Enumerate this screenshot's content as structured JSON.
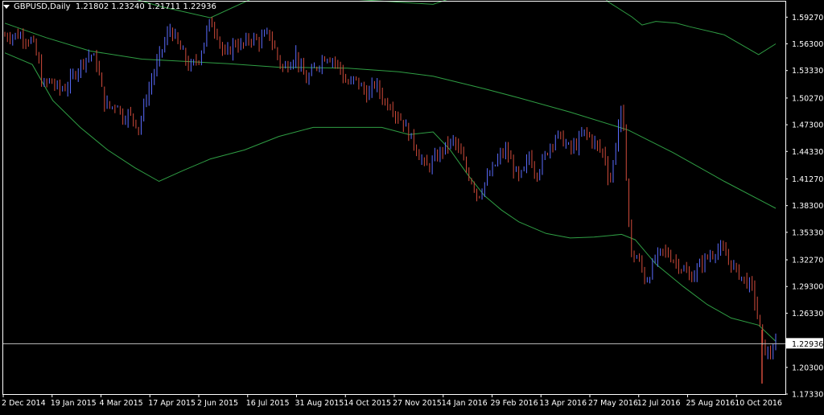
{
  "window": {
    "symbol": "GBPUSD,Daily",
    "ohlc": "1.21802 1.23240 1.21711 1.22936"
  },
  "colors": {
    "background": "#000000",
    "frame": "#ffffff",
    "bull_bar": "#5b6cff",
    "bear_bar": "#d14b3b",
    "band": "#2f9e44",
    "current_price_line": "#c0c0c0",
    "price_label_bg": "#ffffff",
    "price_label_text": "#000000",
    "axis_text": "#ffffff"
  },
  "chart_data": {
    "type": "ohlc-bar",
    "symbol": "GBPUSD",
    "timeframe": "Daily",
    "current_price": 1.22936,
    "y_ticks": [
      "1.59270",
      "1.56300",
      "1.53330",
      "1.50270",
      "1.47300",
      "1.44330",
      "1.41270",
      "1.38300",
      "1.35330",
      "1.32270",
      "1.29300",
      "1.26330",
      "1.20300",
      "1.17330"
    ],
    "ylim": [
      1.1733,
      1.61
    ],
    "x_ticks": [
      "2 Dec 2014",
      "19 Jan 2015",
      "4 Mar 2015",
      "17 Apr 2015",
      "2 Jun 2015",
      "16 Jul 2015",
      "31 Aug 2015",
      "14 Oct 2015",
      "27 Nov 2015",
      "14 Jan 2016",
      "29 Feb 2016",
      "13 Apr 2016",
      "27 May 2016",
      "12 Jul 2016",
      "25 Aug 2016",
      "10 Oct 2016"
    ],
    "price_path": [
      [
        0,
        1.572
      ],
      [
        4,
        1.573
      ],
      [
        8,
        1.566
      ],
      [
        10,
        1.54
      ],
      [
        11,
        1.515
      ],
      [
        13,
        1.522
      ],
      [
        16,
        1.512
      ],
      [
        18,
        1.515
      ],
      [
        20,
        1.528
      ],
      [
        23,
        1.545
      ],
      [
        25,
        1.552
      ],
      [
        27,
        1.54
      ],
      [
        28,
        1.518
      ],
      [
        29,
        1.497
      ],
      [
        31,
        1.492
      ],
      [
        33,
        1.498
      ],
      [
        34,
        1.48
      ],
      [
        36,
        1.485
      ],
      [
        38,
        1.478
      ],
      [
        39,
        1.468
      ],
      [
        41,
        1.5
      ],
      [
        43,
        1.525
      ],
      [
        45,
        1.548
      ],
      [
        47,
        1.568
      ],
      [
        48,
        1.58
      ],
      [
        49,
        1.575
      ],
      [
        51,
        1.558
      ],
      [
        52,
        1.552
      ],
      [
        54,
        1.535
      ],
      [
        56,
        1.545
      ],
      [
        57,
        1.55
      ],
      [
        59,
        1.578
      ],
      [
        60,
        1.588
      ],
      [
        62,
        1.575
      ],
      [
        63,
        1.562
      ],
      [
        64,
        1.548
      ],
      [
        66,
        1.558
      ],
      [
        67,
        1.565
      ],
      [
        69,
        1.56
      ],
      [
        71,
        1.567
      ],
      [
        72,
        1.57
      ],
      [
        74,
        1.565
      ],
      [
        76,
        1.572
      ],
      [
        77,
        1.575
      ],
      [
        79,
        1.555
      ],
      [
        80,
        1.545
      ],
      [
        81,
        1.535
      ],
      [
        83,
        1.542
      ],
      [
        85,
        1.552
      ],
      [
        86,
        1.538
      ],
      [
        88,
        1.522
      ],
      [
        89,
        1.528
      ],
      [
        91,
        1.538
      ],
      [
        93,
        1.548
      ],
      [
        94,
        1.55
      ],
      [
        96,
        1.545
      ],
      [
        98,
        1.535
      ],
      [
        99,
        1.522
      ],
      [
        101,
        1.518
      ],
      [
        102,
        1.525
      ],
      [
        104,
        1.515
      ],
      [
        106,
        1.505
      ],
      [
        108,
        1.52
      ],
      [
        109,
        1.512
      ],
      [
        111,
        1.498
      ],
      [
        113,
        1.495
      ],
      [
        114,
        1.485
      ],
      [
        116,
        1.478
      ],
      [
        118,
        1.462
      ],
      [
        120,
        1.448
      ],
      [
        121,
        1.438
      ],
      [
        123,
        1.425
      ],
      [
        125,
        1.432
      ],
      [
        127,
        1.442
      ],
      [
        129,
        1.45
      ],
      [
        131,
        1.455
      ],
      [
        133,
        1.44
      ],
      [
        135,
        1.42
      ],
      [
        137,
        1.405
      ],
      [
        138,
        1.392
      ],
      [
        140,
        1.408
      ],
      [
        142,
        1.42
      ],
      [
        144,
        1.435
      ],
      [
        146,
        1.445
      ],
      [
        148,
        1.43
      ],
      [
        150,
        1.412
      ],
      [
        152,
        1.425
      ],
      [
        153,
        1.44
      ],
      [
        155,
        1.418
      ],
      [
        157,
        1.432
      ],
      [
        159,
        1.45
      ],
      [
        161,
        1.462
      ],
      [
        163,
        1.455
      ],
      [
        165,
        1.445
      ],
      [
        167,
        1.452
      ],
      [
        169,
        1.465
      ],
      [
        171,
        1.458
      ],
      [
        173,
        1.448
      ],
      [
        175,
        1.44
      ],
      [
        176,
        1.418
      ],
      [
        177,
        1.412
      ],
      [
        178,
        1.445
      ],
      [
        179,
        1.47
      ],
      [
        180,
        1.492
      ],
      [
        181,
        1.442
      ],
      [
        182,
        1.375
      ],
      [
        183,
        1.32
      ],
      [
        184,
        1.33
      ],
      [
        186,
        1.312
      ],
      [
        187,
        1.298
      ],
      [
        188,
        1.305
      ],
      [
        190,
        1.325
      ],
      [
        192,
        1.332
      ],
      [
        194,
        1.328
      ],
      [
        196,
        1.32
      ],
      [
        198,
        1.312
      ],
      [
        200,
        1.302
      ],
      [
        202,
        1.312
      ],
      [
        204,
        1.322
      ],
      [
        206,
        1.328
      ],
      [
        208,
        1.335
      ],
      [
        210,
        1.33
      ],
      [
        212,
        1.318
      ],
      [
        214,
        1.308
      ],
      [
        216,
        1.3
      ],
      [
        218,
        1.292
      ],
      [
        219,
        1.275
      ],
      [
        220,
        1.255
      ],
      [
        221,
        1.23
      ],
      [
        222,
        1.222
      ],
      [
        223,
        1.215
      ],
      [
        224,
        1.225
      ],
      [
        225,
        1.228
      ]
    ],
    "flash_crash": {
      "index": 221,
      "low": 1.185,
      "high": 1.245
    },
    "upper_band": [
      [
        0,
        1.659
      ],
      [
        14,
        1.642
      ],
      [
        30,
        1.622
      ],
      [
        45,
        1.605
      ],
      [
        60,
        1.592
      ],
      [
        72,
        1.613
      ],
      [
        78,
        1.613
      ],
      [
        100,
        1.613
      ],
      [
        125,
        1.607
      ],
      [
        132,
        1.616
      ],
      [
        138,
        1.627
      ],
      [
        150,
        1.632
      ],
      [
        165,
        1.64
      ],
      [
        172,
        1.628
      ],
      [
        176,
        1.61
      ],
      [
        183,
        1.593
      ],
      [
        186,
        1.584
      ],
      [
        190,
        1.588
      ],
      [
        196,
        1.586
      ],
      [
        200,
        1.582
      ],
      [
        210,
        1.573
      ],
      [
        220,
        1.551
      ],
      [
        225,
        1.563
      ]
    ],
    "middle_band": [
      [
        0,
        1.586
      ],
      [
        12,
        1.57
      ],
      [
        25,
        1.555
      ],
      [
        40,
        1.546
      ],
      [
        55,
        1.543
      ],
      [
        65,
        1.541
      ],
      [
        80,
        1.537
      ],
      [
        100,
        1.536
      ],
      [
        115,
        1.532
      ],
      [
        125,
        1.527
      ],
      [
        140,
        1.513
      ],
      [
        150,
        1.503
      ],
      [
        165,
        1.487
      ],
      [
        182,
        1.467
      ],
      [
        195,
        1.442
      ],
      [
        210,
        1.41
      ],
      [
        225,
        1.38
      ]
    ],
    "lower_band": [
      [
        0,
        1.553
      ],
      [
        8,
        1.54
      ],
      [
        14,
        1.5
      ],
      [
        22,
        1.47
      ],
      [
        30,
        1.445
      ],
      [
        38,
        1.425
      ],
      [
        45,
        1.41
      ],
      [
        52,
        1.422
      ],
      [
        60,
        1.435
      ],
      [
        70,
        1.445
      ],
      [
        80,
        1.46
      ],
      [
        90,
        1.47
      ],
      [
        100,
        1.47
      ],
      [
        110,
        1.47
      ],
      [
        118,
        1.462
      ],
      [
        125,
        1.465
      ],
      [
        130,
        1.445
      ],
      [
        135,
        1.418
      ],
      [
        140,
        1.394
      ],
      [
        145,
        1.378
      ],
      [
        150,
        1.365
      ],
      [
        158,
        1.352
      ],
      [
        165,
        1.347
      ],
      [
        172,
        1.348
      ],
      [
        180,
        1.351
      ],
      [
        184,
        1.345
      ],
      [
        190,
        1.318
      ],
      [
        198,
        1.293
      ],
      [
        205,
        1.273
      ],
      [
        212,
        1.258
      ],
      [
        220,
        1.25
      ],
      [
        225,
        1.232
      ]
    ]
  }
}
